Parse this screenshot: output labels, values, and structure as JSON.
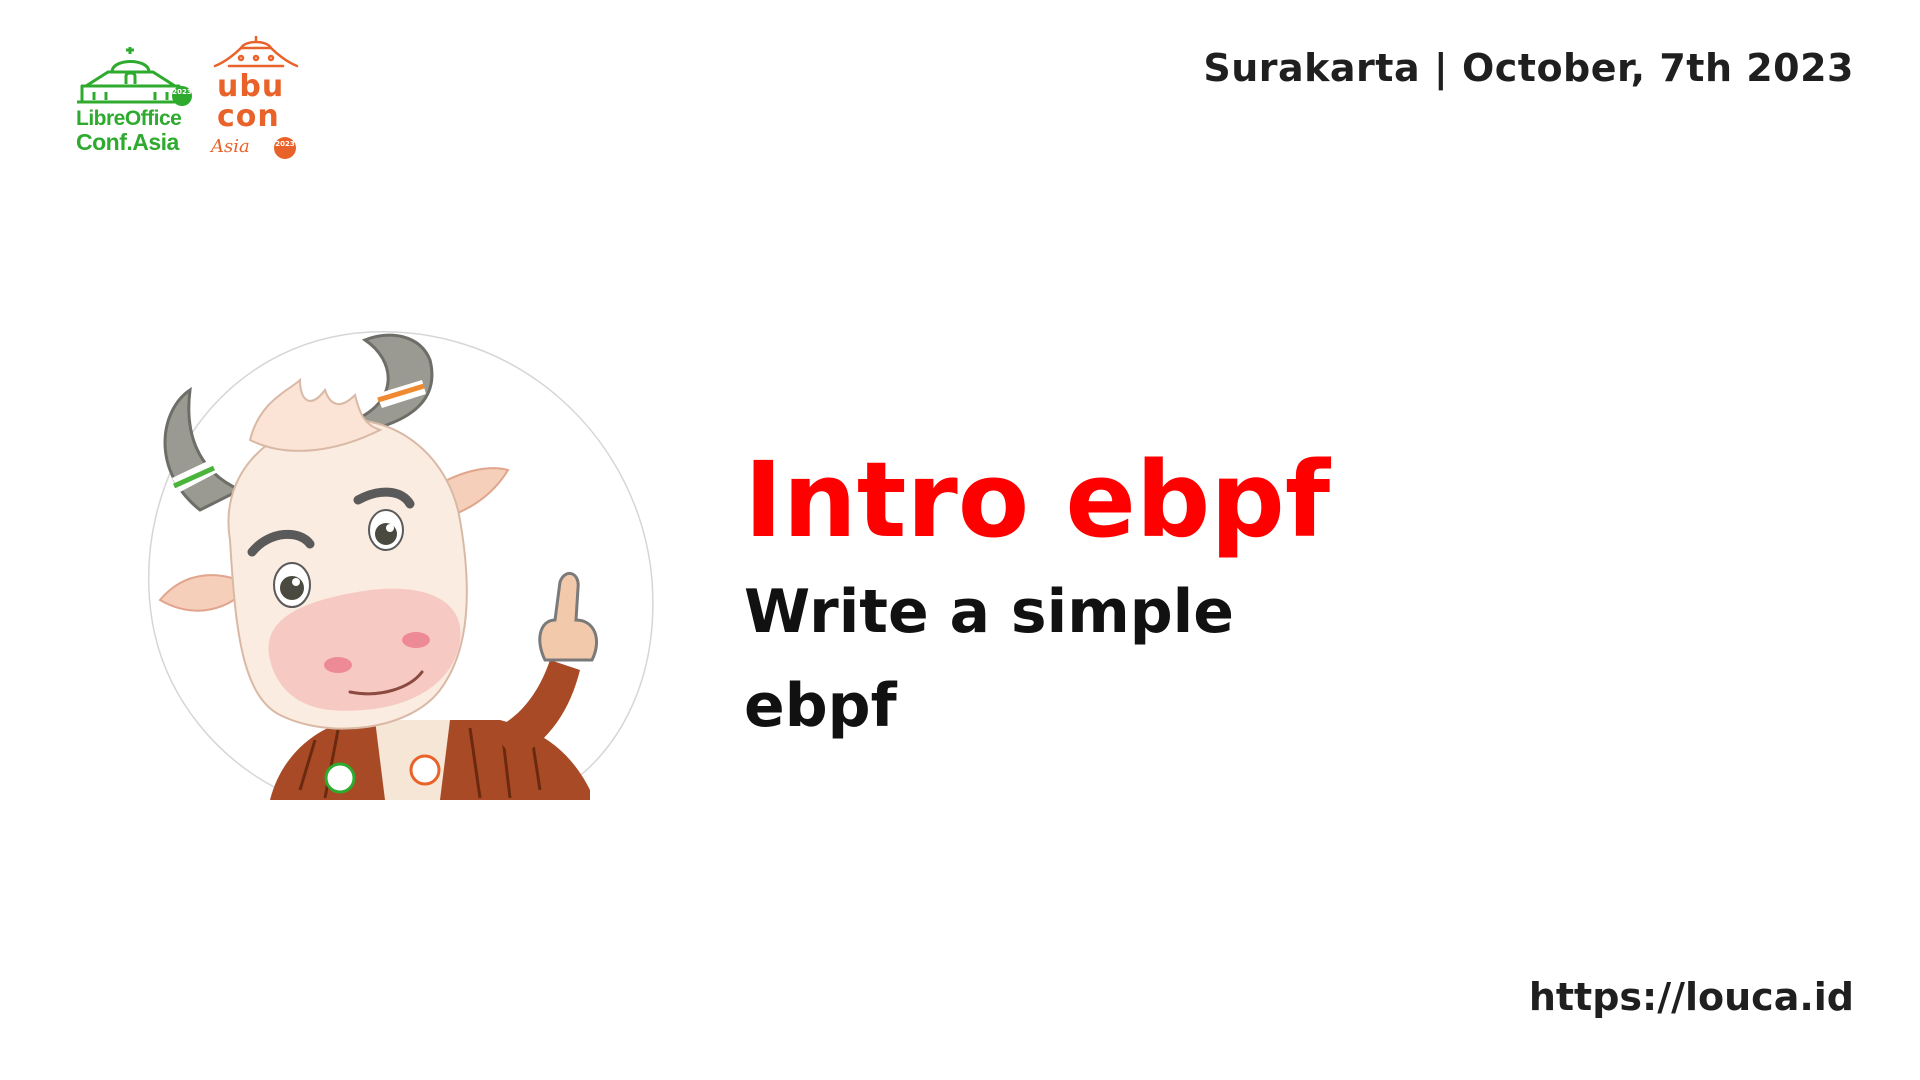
{
  "header": {
    "event_info": "Surakarta | October, 7th 2023"
  },
  "logos": {
    "libreoffice": {
      "line1": "LibreOffice",
      "line2": "Conf.Asia",
      "year_badge": "2023",
      "color": "#2eab2e"
    },
    "ubucon": {
      "line1": "ubu",
      "line2": "con",
      "script": "Asia",
      "year_badge": "2023",
      "color": "#e9622a"
    }
  },
  "mascot": {
    "icon": "cow-mascot-thumbs-up"
  },
  "main": {
    "title": "Intro ebpf",
    "subtitle": "Write a simple ebpf",
    "title_color": "#ff0000"
  },
  "footer": {
    "url": "https://louca.id"
  }
}
